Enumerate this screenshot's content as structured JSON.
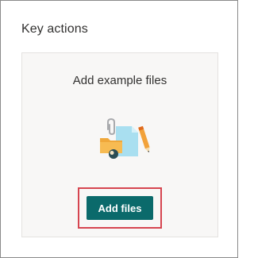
{
  "section": {
    "title": "Key actions"
  },
  "card": {
    "title": "Add example files",
    "illustration_icon": "files-illustration-icon",
    "button_label": "Add files"
  },
  "colors": {
    "button_bg": "#0b6a6b",
    "highlight_border": "#d64550",
    "card_bg": "#f8f7f6"
  }
}
